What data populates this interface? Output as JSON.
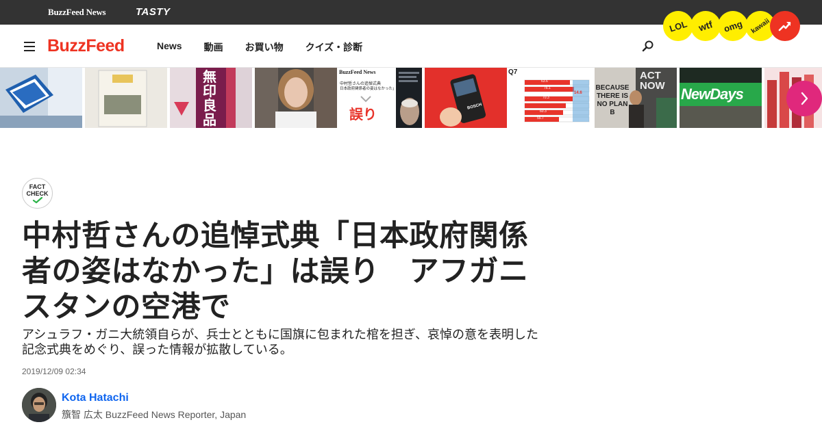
{
  "topbar": {
    "brand_news": "BuzzFeed News",
    "brand_tasty": "TASTY"
  },
  "nav": {
    "logo": "BuzzFeed",
    "links": [
      "News",
      "動画",
      "お買い物",
      "クイズ・診断"
    ],
    "search_icon": "magnifier-icon",
    "menu_icon": "hamburger-icon"
  },
  "badges": {
    "lol": "LOL",
    "wtf": "wtf",
    "omg": "omg",
    "kawaii": "kawaii",
    "trending_icon": "trending-arrow-icon"
  },
  "strip": {
    "thumb3_text": "無印良品",
    "thumb5_brand": "BuzzFeed News",
    "thumb5_line1": "中村哲さんの追悼式典",
    "thumb5_line2": "日本政府関係者の姿はなかった」",
    "thumb5_label": "誤り",
    "thumb7_brand": "BOSCH",
    "thumb8_label": "Q7",
    "thumb8_values": [
      "63.6",
      "76.1",
      "14.6",
      "70.3",
      "60.3",
      "55.7"
    ],
    "thumb9_text": "BECAUSE THERE IS NO PLAN B",
    "thumb9_top": "ACT NOW",
    "thumb10_text": "NewDays",
    "next_icon": "chevron-right-icon"
  },
  "article": {
    "factcheck_line1": "FACT",
    "factcheck_line2": "CHECK",
    "headline": "中村哲さんの追悼式典「日本政府関係者の姿はなかった」は誤り　アフガニスタンの空港で",
    "dek": "アシュラフ・ガニ大統領自らが、兵士とともに国旗に包まれた棺を担ぎ、哀悼の意を表明した記念式典をめぐり、誤った情報が拡散している。",
    "timestamp": "2019/12/09 02:34",
    "author_name": "Kota Hatachi",
    "author_role": "籏智 広太 BuzzFeed News Reporter, Japan"
  },
  "colors": {
    "brand_red": "#ee3322",
    "badge_yellow": "#ffee00",
    "link_blue": "#0f65ef",
    "arrow_pink": "#e0287c"
  }
}
